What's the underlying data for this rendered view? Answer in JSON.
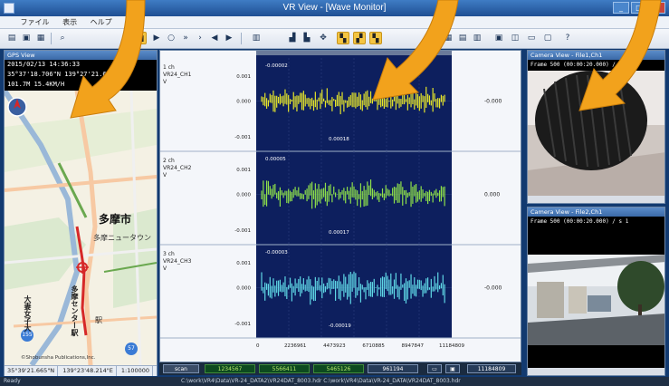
{
  "window": {
    "title": "VR View - [Wave Monitor]",
    "controls": [
      "_",
      "□",
      "×"
    ]
  },
  "menu": {
    "items": [
      "ファイル",
      "表示",
      "ヘルプ"
    ]
  },
  "gps": {
    "pane_title": "GPS View",
    "info_lines": [
      "2015/02/13 14:36:33",
      "35°37'18.706\"N 139°27'21.665\"E",
      "101.7M  15.4KM/H"
    ],
    "map_labels": {
      "tama_city": "多摩市",
      "tama_center": "多摩センター駅",
      "tama_newtown": "多摩ニュータウン",
      "univ": "大妻女子大",
      "station": "駅",
      "copyright": "©Shobunsha Publications,Inc.",
      "route_155": "155",
      "route_57": "57"
    },
    "status": [
      "35°39'21.665\"N",
      "139°23'48.214\"E",
      "1:100000"
    ]
  },
  "wave": {
    "channels": [
      {
        "label": "1 ch",
        "name": "VR24_CH1",
        "unit": "V",
        "ticks": [
          "0.001",
          "0.000",
          "-0.001"
        ],
        "top_value": "-0.00002",
        "bottom_value": "0.00018",
        "right_value": "-0.000",
        "color": "#e6e62a"
      },
      {
        "label": "2 ch",
        "name": "VR24_CH2",
        "unit": "V",
        "ticks": [
          "0.001",
          "0.000",
          "-0.001"
        ],
        "top_value": "0.00005",
        "bottom_value": "0.00017",
        "right_value": "0.000",
        "color": "#8ee04a"
      },
      {
        "label": "3 ch",
        "name": "VR24_CH3",
        "unit": "V",
        "ticks": [
          "0.001",
          "0.000",
          "-0.001"
        ],
        "top_value": "-0.00003",
        "bottom_value": "-0.00019",
        "right_value": "-0.000",
        "color": "#5fd7e6"
      }
    ],
    "x_ticks": [
      "0",
      "2236961",
      "4473923",
      "6710885",
      "8947847",
      "11184809"
    ],
    "plot_bg": "#0d1f5e"
  },
  "bottom_bar": {
    "scan": "scan",
    "values": [
      "1234567",
      "5566411",
      "5465126",
      "961194"
    ],
    "end_value": "11184809"
  },
  "cameras": [
    {
      "pane_title": "Camera View - File1,Ch1",
      "frame_info": "Frame 500 (00:00:20.000) / s 1"
    },
    {
      "pane_title": "Camera View - File2,Ch1",
      "frame_info": "Frame 500 (00:00:20.000) / s 1"
    }
  ],
  "statusbar": {
    "ready": "Ready",
    "path": "C:\\work\\VR4\\Data\\VR-24_DATA2\\VR24DAT_8003.hdr  C:\\work\\VR4\\Data\\VR-24_DATA\\VR24DAT_8003.hdr"
  },
  "colors": {
    "arrow": "#f2a21c",
    "title_bar": "#2c63ad",
    "plot_background": "#0d1f5e"
  }
}
